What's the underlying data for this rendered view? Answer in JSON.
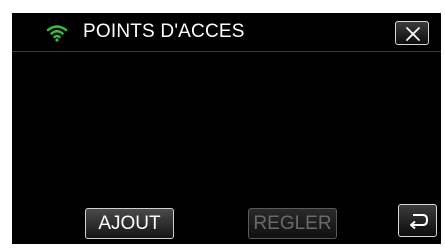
{
  "header": {
    "title": "POINTS D'ACCES",
    "wifi_icon": "wifi-icon",
    "wifi_color": "#3dbb3d",
    "close_icon": "close-icon"
  },
  "footer": {
    "add_label": "AJOUT",
    "set_label": "REGLER",
    "back_icon": "back-icon"
  }
}
